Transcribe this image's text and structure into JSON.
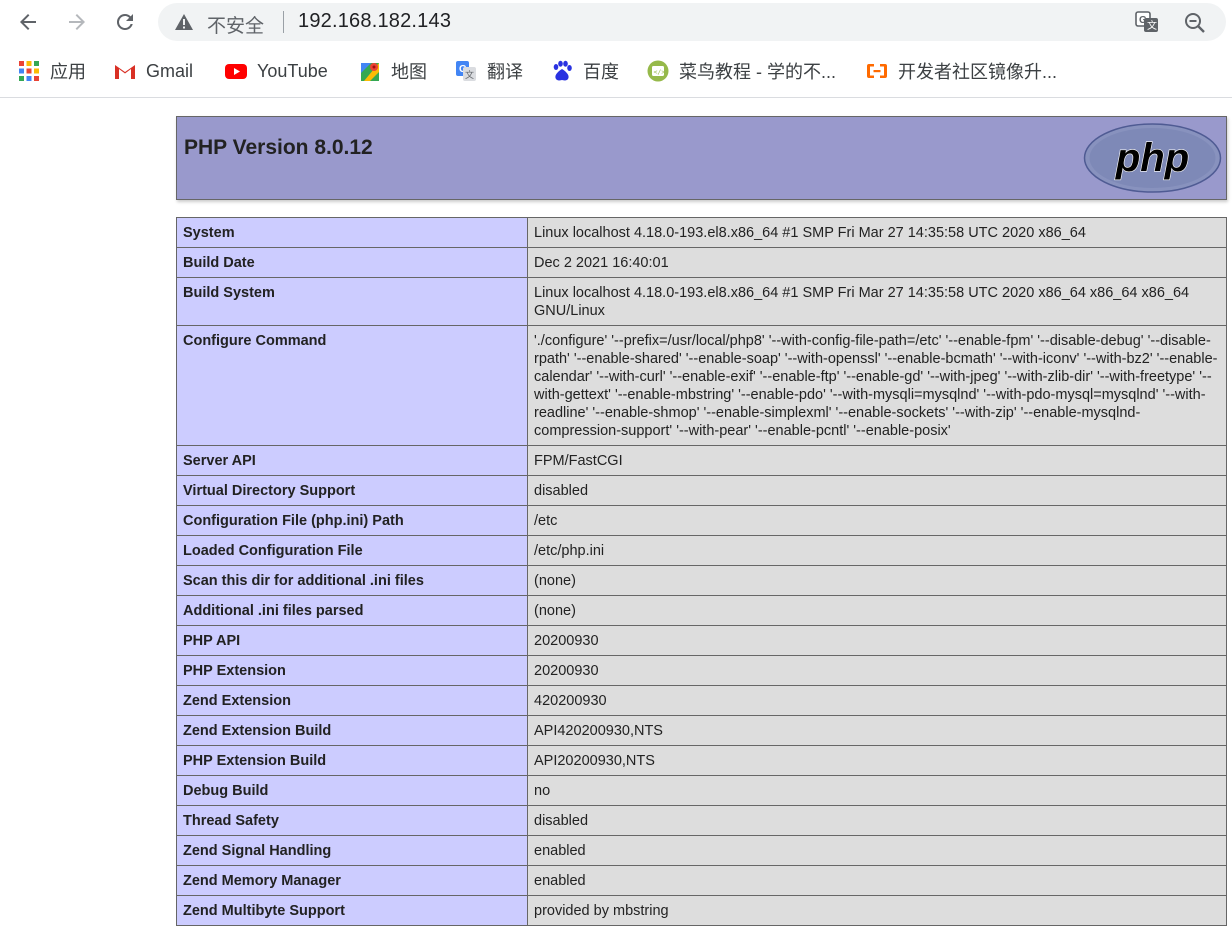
{
  "browser": {
    "security_label": "不安全",
    "url": "192.168.182.143",
    "bookmarks": [
      {
        "label": "应用",
        "icon": "apps-grid-icon"
      },
      {
        "label": "Gmail",
        "icon": "gmail-icon"
      },
      {
        "label": "YouTube",
        "icon": "youtube-icon"
      },
      {
        "label": "地图",
        "icon": "maps-icon"
      },
      {
        "label": "翻译",
        "icon": "translate-icon"
      },
      {
        "label": "百度",
        "icon": "baidu-icon"
      },
      {
        "label": "菜鸟教程 - 学的不...",
        "icon": "runoob-icon"
      },
      {
        "label": "开发者社区镜像升...",
        "icon": "aliyun-icon"
      }
    ]
  },
  "php": {
    "header_title": "PHP Version 8.0.12",
    "logo_text": "php",
    "rows": [
      {
        "key": "System",
        "value": "Linux localhost 4.18.0-193.el8.x86_64 #1 SMP Fri Mar 27 14:35:58 UTC 2020 x86_64"
      },
      {
        "key": "Build Date",
        "value": "Dec 2 2021 16:40:01"
      },
      {
        "key": "Build System",
        "value": "Linux localhost 4.18.0-193.el8.x86_64 #1 SMP Fri Mar 27 14:35:58 UTC 2020 x86_64 x86_64 x86_64 GNU/Linux"
      },
      {
        "key": "Configure Command",
        "value": "'./configure' '--prefix=/usr/local/php8' '--with-config-file-path=/etc' '--enable-fpm' '--disable-debug' '--disable-rpath' '--enable-shared' '--enable-soap' '--with-openssl' '--enable-bcmath' '--with-iconv' '--with-bz2' '--enable-calendar' '--with-curl' '--enable-exif' '--enable-ftp' '--enable-gd' '--with-jpeg' '--with-zlib-dir' '--with-freetype' '--with-gettext' '--enable-mbstring' '--enable-pdo' '--with-mysqli=mysqlnd' '--with-pdo-mysql=mysqlnd' '--with-readline' '--enable-shmop' '--enable-simplexml' '--enable-sockets' '--with-zip' '--enable-mysqlnd-compression-support' '--with-pear' '--enable-pcntl' '--enable-posix'"
      },
      {
        "key": "Server API",
        "value": "FPM/FastCGI"
      },
      {
        "key": "Virtual Directory Support",
        "value": "disabled"
      },
      {
        "key": "Configuration File (php.ini) Path",
        "value": "/etc"
      },
      {
        "key": "Loaded Configuration File",
        "value": "/etc/php.ini"
      },
      {
        "key": "Scan this dir for additional .ini files",
        "value": "(none)"
      },
      {
        "key": "Additional .ini files parsed",
        "value": "(none)"
      },
      {
        "key": "PHP API",
        "value": "20200930"
      },
      {
        "key": "PHP Extension",
        "value": "20200930"
      },
      {
        "key": "Zend Extension",
        "value": "420200930"
      },
      {
        "key": "Zend Extension Build",
        "value": "API420200930,NTS"
      },
      {
        "key": "PHP Extension Build",
        "value": "API20200930,NTS"
      },
      {
        "key": "Debug Build",
        "value": "no"
      },
      {
        "key": "Thread Safety",
        "value": "disabled"
      },
      {
        "key": "Zend Signal Handling",
        "value": "enabled"
      },
      {
        "key": "Zend Memory Manager",
        "value": "enabled"
      },
      {
        "key": "Zend Multibyte Support",
        "value": "provided by mbstring"
      }
    ]
  }
}
